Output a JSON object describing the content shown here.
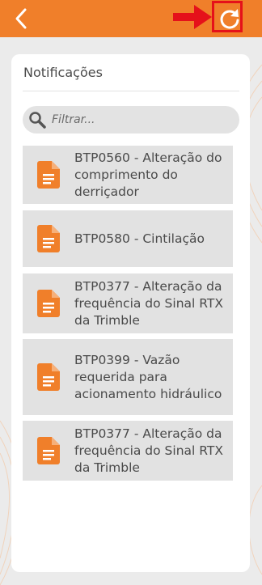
{
  "header": {
    "back_icon": "chevron-left-icon",
    "refresh_icon": "refresh-icon",
    "color": "#f07f2a"
  },
  "annotation": {
    "arrow_color": "#e5111a"
  },
  "panel": {
    "title": "Notificações"
  },
  "search": {
    "placeholder": "Filtrar...",
    "value": ""
  },
  "notifications": [
    {
      "text": "BTP0560 - Alteração do comprimento do derriçador",
      "icon": "document-icon"
    },
    {
      "text": "BTP0580 - Cintilação",
      "icon": "document-icon"
    },
    {
      "text": "BTP0377 - Alteração da frequência do Sinal RTX da Trimble",
      "icon": "document-icon"
    },
    {
      "text": "BTP0399 - Vazão requerida para acionamento hidráulico",
      "icon": "document-icon"
    },
    {
      "text": "BTP0377 - Alteração da frequência do Sinal RTX da Trimble",
      "icon": "document-icon"
    }
  ]
}
